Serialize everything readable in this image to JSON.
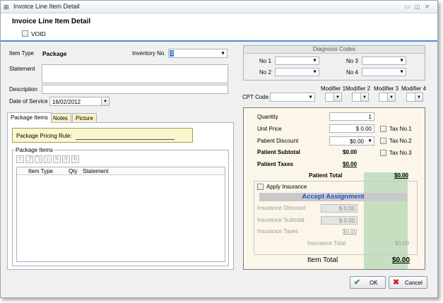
{
  "window": {
    "title": "Invoice Line Item Detail"
  },
  "header": {
    "title": "Invoice Line Item Detail",
    "void_label": "VOID"
  },
  "left": {
    "item_type_label": "Item Type",
    "item_type_value": "Package",
    "inventory_label": "Inventory No.",
    "inventory_value": "0",
    "statement_label": "Statement",
    "description_label": "Description",
    "date_label": "Date of Service",
    "date_value": "16/02/2012",
    "tabs": [
      "Package Items",
      "Notes",
      "Picture"
    ],
    "pricing_rule_label": "Package Pricing Rule:",
    "package_items_label": "Package Items",
    "columns": [
      "Item Type",
      "Qty",
      "Statement"
    ]
  },
  "diagnosis": {
    "title": "Diagnosis Codes",
    "no1": "No 1",
    "no2": "No 2",
    "no3": "No 3",
    "no4": "No 4"
  },
  "cpt": {
    "label": "CPT Code",
    "mod1": "Modifier 1",
    "mod2": "Modifier 2",
    "mod3": "Modifier 3",
    "mod4": "Modifier 4"
  },
  "pricing": {
    "quantity_label": "Quantity",
    "quantity_value": "1",
    "unit_price_label": "Unit Price",
    "unit_price_value": "$ 0.00",
    "patient_discount_label": "Patient Discount",
    "patient_discount_value": "$0.00",
    "patient_subtotal_label": "Patient Subtotal",
    "patient_subtotal_value": "$0.00",
    "patient_taxes_label": "Patient Taxes",
    "patient_taxes_value": "$0.00",
    "tax1": "Tax No.1",
    "tax2": "Tax No.2",
    "tax3": "Tax No.3",
    "patient_total_label": "Patient Total",
    "patient_total_value": "$0.00",
    "apply_insurance_label": "Apply Insurance",
    "accept_assignment": "Accept Assignment",
    "insurance_discount_label": "Insurance Discount",
    "insurance_discount_value": "$ 0.00",
    "insurance_subtotal_label": "Insurance Subtotal",
    "insurance_subtotal_value": "$ 0.00",
    "insurance_taxes_label": "Insurance Taxes",
    "insurance_taxes_value": "$0.00",
    "insurance_total_label": "Insurance Total",
    "insurance_total_value": "$0.00",
    "item_total_label": "Item Total",
    "item_total_value": "$0.00"
  },
  "footer": {
    "ok": "OK",
    "cancel": "Cancel"
  },
  "colors": {
    "accent": "#4a90d9",
    "panel_bg": "#fbf6e9",
    "total_col": "#c5dfc0",
    "accept_text": "#1f4fd6"
  },
  "icons": [
    "app-icon",
    "minimize-icon",
    "maximize-icon",
    "close-icon",
    "check-icon",
    "x-icon"
  ]
}
